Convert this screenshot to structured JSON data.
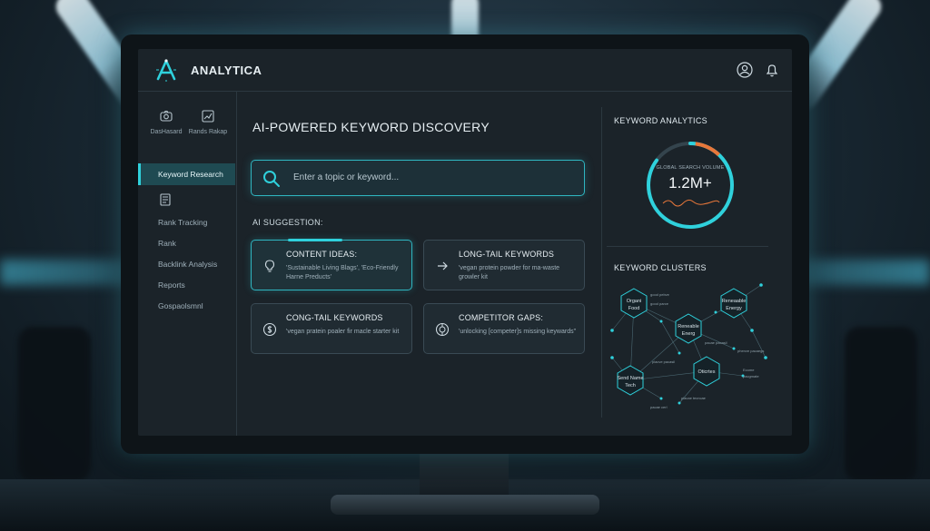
{
  "app": {
    "brand": "ANALYTICA"
  },
  "header_icons": [
    "user-icon",
    "bell-icon"
  ],
  "sidebar": {
    "top_items": [
      {
        "label": "DasHasard"
      },
      {
        "label": "Rands Rakap"
      }
    ],
    "items": [
      {
        "label": "Keyword Research",
        "active": true
      },
      {
        "label": "Rank Tracking"
      },
      {
        "label": "Rank"
      },
      {
        "label": "Backlink Analysis"
      },
      {
        "label": "Reports"
      },
      {
        "label": "Gospaolsmnl"
      }
    ]
  },
  "main": {
    "title": "AI-POWERED KEYWORD DISCOVERY",
    "search": {
      "placeholder": "Enter a topic or keyword..."
    },
    "ai_label": "AI SUGGESTION:",
    "cards": [
      {
        "title": "CONTENT IDEAS:",
        "text": "'Sustainable Living Blags', 'Eco-Friendly Harne Preducts'",
        "icon": "lightbulb-icon"
      },
      {
        "title": "LONG-TAIL KEYWORDS",
        "text": "'vegan protein powder for ma-waste growler kit",
        "icon": "arrow-right-icon"
      },
      {
        "title": "CONG-TAIL KEYWORDS",
        "text": "'vegan pratein poaler fir macle starter kit",
        "icon": "dollar-icon"
      },
      {
        "title": "COMPETITOR GAPS:",
        "text": "'unlocking [competer]s missing keywards\"",
        "icon": "gap-icon"
      }
    ]
  },
  "analytics": {
    "title": "KEYWORD ANALYTICS",
    "gauge_label": "GLOBAL SEARCH VOLUME",
    "gauge_value": "1.2M+",
    "gauge_fill": 0.85,
    "colors": {
      "accent": "#2fd1dc",
      "highlight": "#e8773a"
    }
  },
  "clusters": {
    "title": "KEYWORD CLUSTERS",
    "nodes": [
      {
        "line1": "Organi",
        "line2": "Food"
      },
      {
        "line1": "Reneaable",
        "line2": "Energy"
      },
      {
        "line1": "Reneable",
        "line2": "Energ"
      },
      {
        "line1": "Send Name",
        "line2": "Tech"
      },
      {
        "line1": "Oticrtes",
        "line2": ""
      }
    ],
    "small_labels": [
      "good pebve",
      "good parce",
      "pacae pacasil",
      "phenve pacaegs",
      "placve pacasil",
      "Ecome",
      "pacgmate",
      "placae tecncae",
      "pacae cerl"
    ]
  }
}
